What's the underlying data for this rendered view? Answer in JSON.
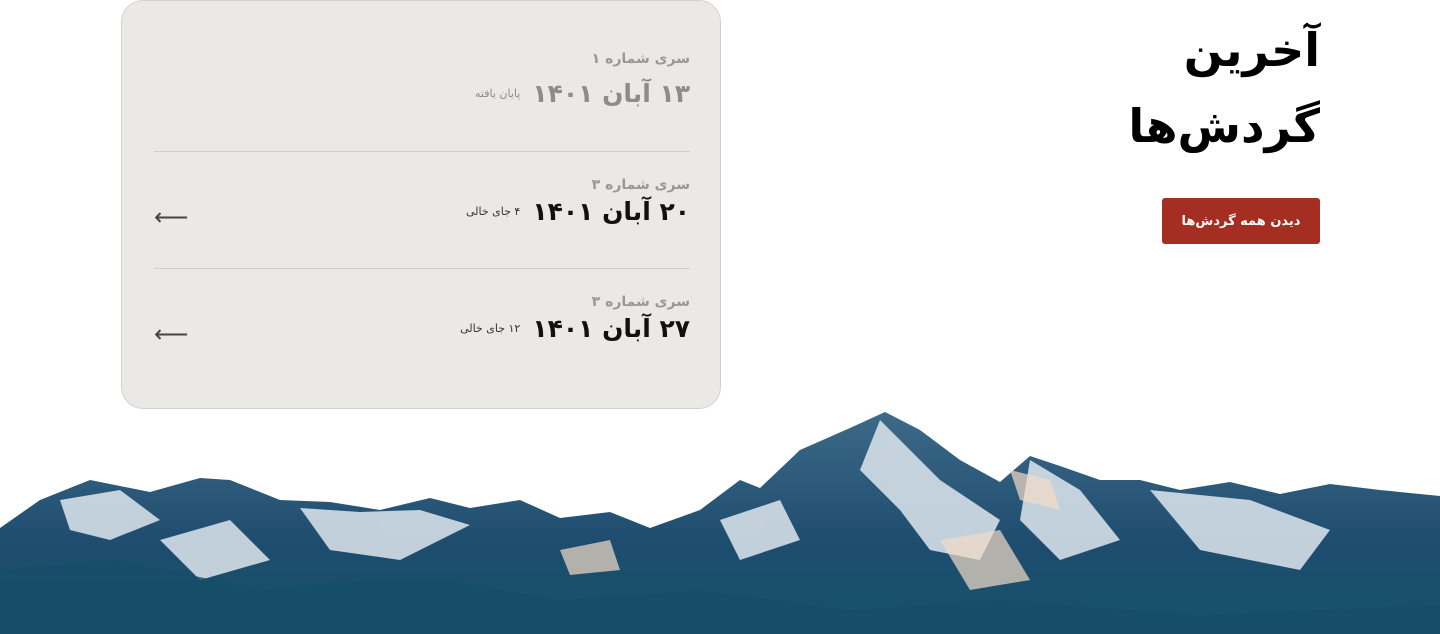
{
  "heading": {
    "line1": "آخرین",
    "line2": "گردش‌ها"
  },
  "view_all_button": "دیدن همه گردش‌ها",
  "tours": [
    {
      "series": "سری شماره ۱",
      "date": "۱۳ آبان ۱۴۰۱",
      "status": "پایان یافته",
      "finished": true
    },
    {
      "series": "سری شماره ۳",
      "date": "۲۰ آبان ۱۴۰۱",
      "status": "۴ جای خالی",
      "finished": false
    },
    {
      "series": "سری شماره ۳",
      "date": "۲۷ آبان ۱۴۰۱",
      "status": "۱۲ جای خالی",
      "finished": false
    }
  ],
  "colors": {
    "accent": "#a52e22",
    "card_bg": "#ebe9e5"
  }
}
